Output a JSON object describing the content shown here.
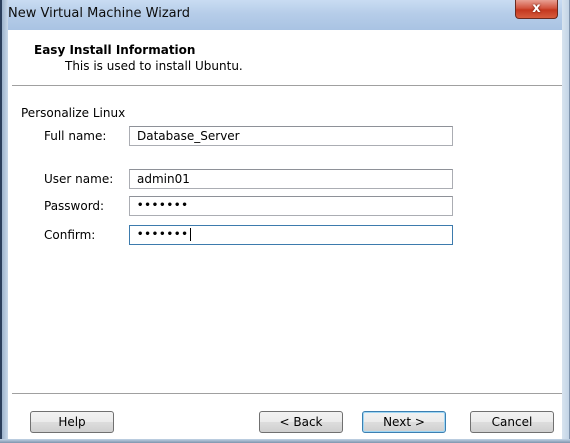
{
  "window": {
    "title": "New Virtual Machine Wizard",
    "close_glyph": "x"
  },
  "header": {
    "title": "Easy Install Information",
    "subtitle": "This is used to install Ubuntu."
  },
  "section": {
    "label": "Personalize Linux"
  },
  "fields": {
    "full_name": {
      "label": "Full name:",
      "value": "Database_Server"
    },
    "user_name": {
      "label": "User name:",
      "value": "admin01"
    },
    "password": {
      "label": "Password:",
      "value": "•••••••"
    },
    "confirm": {
      "label": "Confirm:",
      "value": "•••••••"
    }
  },
  "buttons": {
    "help": "Help",
    "back": "< Back",
    "next": "Next >",
    "cancel": "Cancel"
  }
}
